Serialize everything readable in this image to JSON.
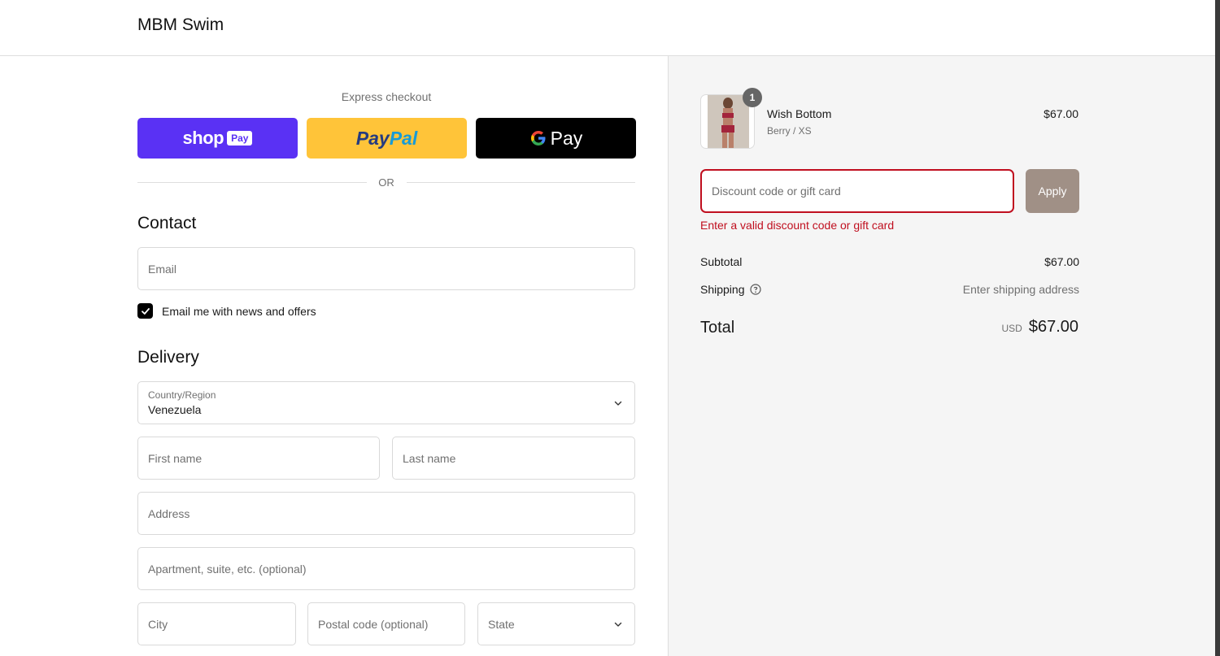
{
  "header": {
    "brand": "MBM Swim"
  },
  "express": {
    "label": "Express checkout",
    "shop_pay": {
      "text": "shop",
      "badge": "Pay"
    },
    "paypal": {
      "part1": "Pay",
      "part2": "Pal"
    },
    "gpay": {
      "text": "Pay"
    },
    "divider": "OR"
  },
  "contact": {
    "title": "Contact",
    "email_placeholder": "Email",
    "newsletter_label": "Email me with news and offers",
    "newsletter_checked": true
  },
  "delivery": {
    "title": "Delivery",
    "country_label": "Country/Region",
    "country_value": "Venezuela",
    "first_name_placeholder": "First name",
    "last_name_placeholder": "Last name",
    "address_placeholder": "Address",
    "apartment_placeholder": "Apartment, suite, etc. (optional)",
    "city_placeholder": "City",
    "postal_placeholder": "Postal code (optional)",
    "state_placeholder": "State"
  },
  "cart": {
    "item": {
      "name": "Wish Bottom",
      "variant": "Berry / XS",
      "price": "$67.00",
      "quantity": "1"
    }
  },
  "discount": {
    "placeholder": "Discount code or gift card",
    "apply_label": "Apply",
    "error": "Enter a valid discount code or gift card"
  },
  "summary": {
    "subtotal_label": "Subtotal",
    "subtotal_value": "$67.00",
    "shipping_label": "Shipping",
    "shipping_value": "Enter shipping address",
    "total_label": "Total",
    "currency": "USD",
    "total_value": "$67.00"
  },
  "colors": {
    "shop_pay": "#5a31f4",
    "paypal": "#ffc439",
    "error": "#c00f1f",
    "apply_button": "#a09086"
  }
}
